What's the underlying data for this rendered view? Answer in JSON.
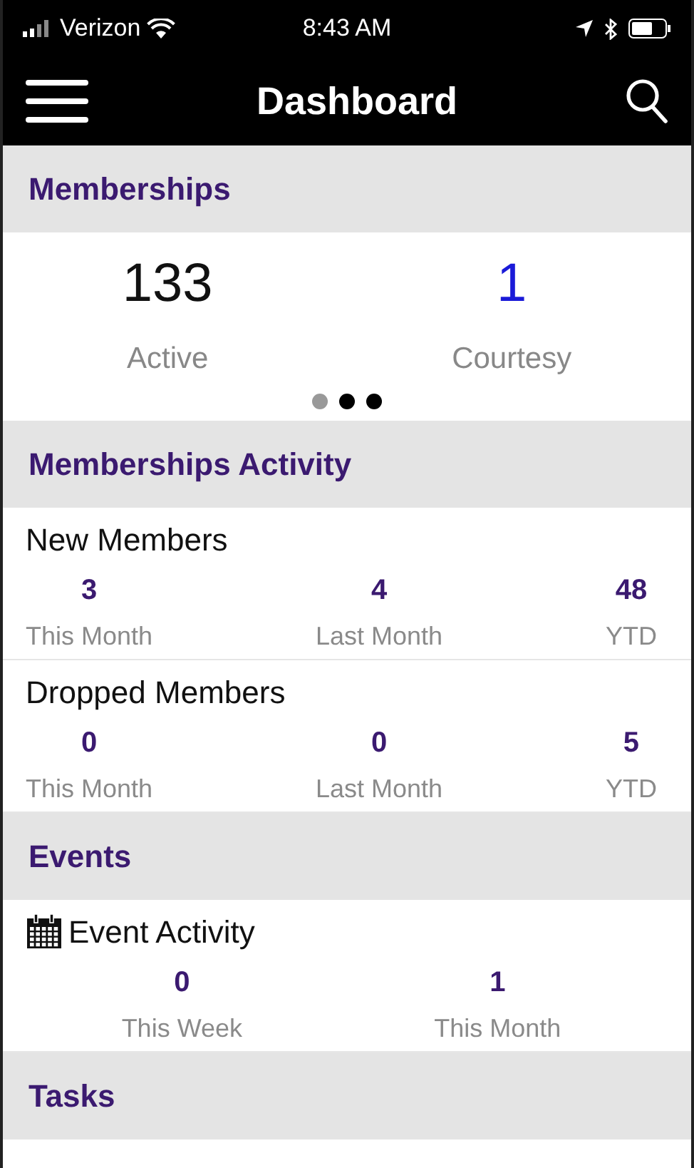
{
  "status_bar": {
    "carrier": "Verizon",
    "time": "8:43 AM"
  },
  "nav_bar": {
    "title": "Dashboard"
  },
  "sections": [
    {
      "title": "Memberships",
      "kind": "totals",
      "stats": [
        {
          "value": "133",
          "label": "Active",
          "color": "#111111"
        },
        {
          "value": "1",
          "label": "Courtesy",
          "color": "#1a1ad8"
        }
      ],
      "page_dots": [
        {
          "selected": true
        },
        {
          "selected": false
        },
        {
          "selected": false
        }
      ]
    },
    {
      "title": "Memberships Activity",
      "kind": "groups",
      "groups": [
        {
          "title": "New Members",
          "stats": [
            {
              "value": "3",
              "label": "This Month"
            },
            {
              "value": "4",
              "label": "Last Month"
            },
            {
              "value": "48",
              "label": "YTD"
            }
          ]
        },
        {
          "title": "Dropped Members",
          "stats": [
            {
              "value": "0",
              "label": "This Month"
            },
            {
              "value": "0",
              "label": "Last Month"
            },
            {
              "value": "5",
              "label": "YTD"
            }
          ]
        }
      ]
    },
    {
      "title": "Events",
      "kind": "groups",
      "groups": [
        {
          "title": "Event Activity",
          "icon": true,
          "stats": [
            {
              "value": "0",
              "label": "This Week"
            },
            {
              "value": "1",
              "label": "This Month"
            }
          ]
        }
      ]
    },
    {
      "title": "Tasks",
      "kind": "header"
    }
  ]
}
